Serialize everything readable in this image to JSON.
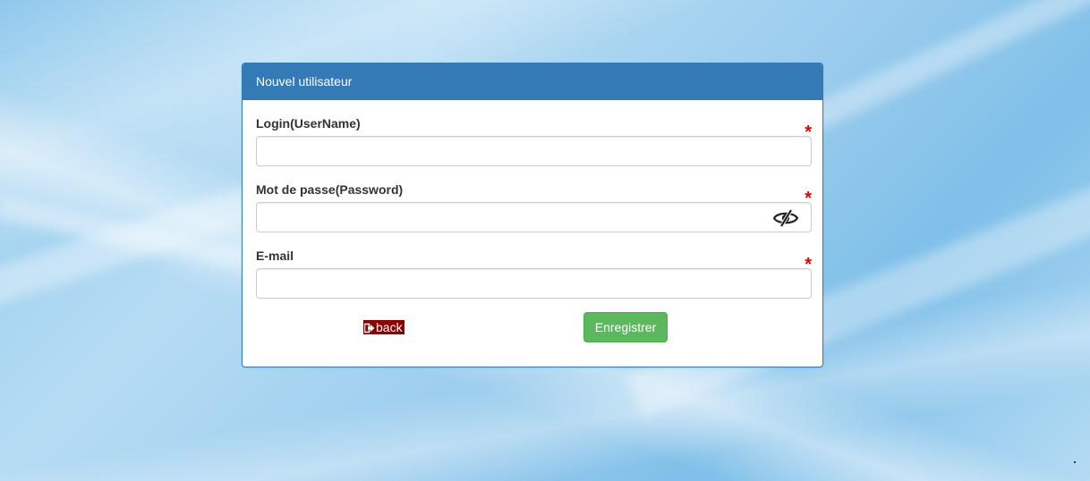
{
  "panel": {
    "title": "Nouvel utilisateur"
  },
  "fields": {
    "login": {
      "label": "Login(UserName)",
      "required_mark": "*",
      "value": "",
      "placeholder": ""
    },
    "password": {
      "label": "Mot de passe(Password)",
      "required_mark": "*",
      "value": "",
      "placeholder": "",
      "toggle_icon": "eye-slash-icon"
    },
    "email": {
      "label": "E-mail",
      "required_mark": "*",
      "value": "",
      "placeholder": ""
    }
  },
  "actions": {
    "back_label": "back",
    "back_icon": "sign-out-arrow-icon",
    "save_label": "Enregistrer"
  },
  "colors": {
    "panel_header": "#337ab7",
    "save_button": "#5cb85c",
    "back_link_bg": "#8b0000",
    "required_mark": "#e00000"
  }
}
